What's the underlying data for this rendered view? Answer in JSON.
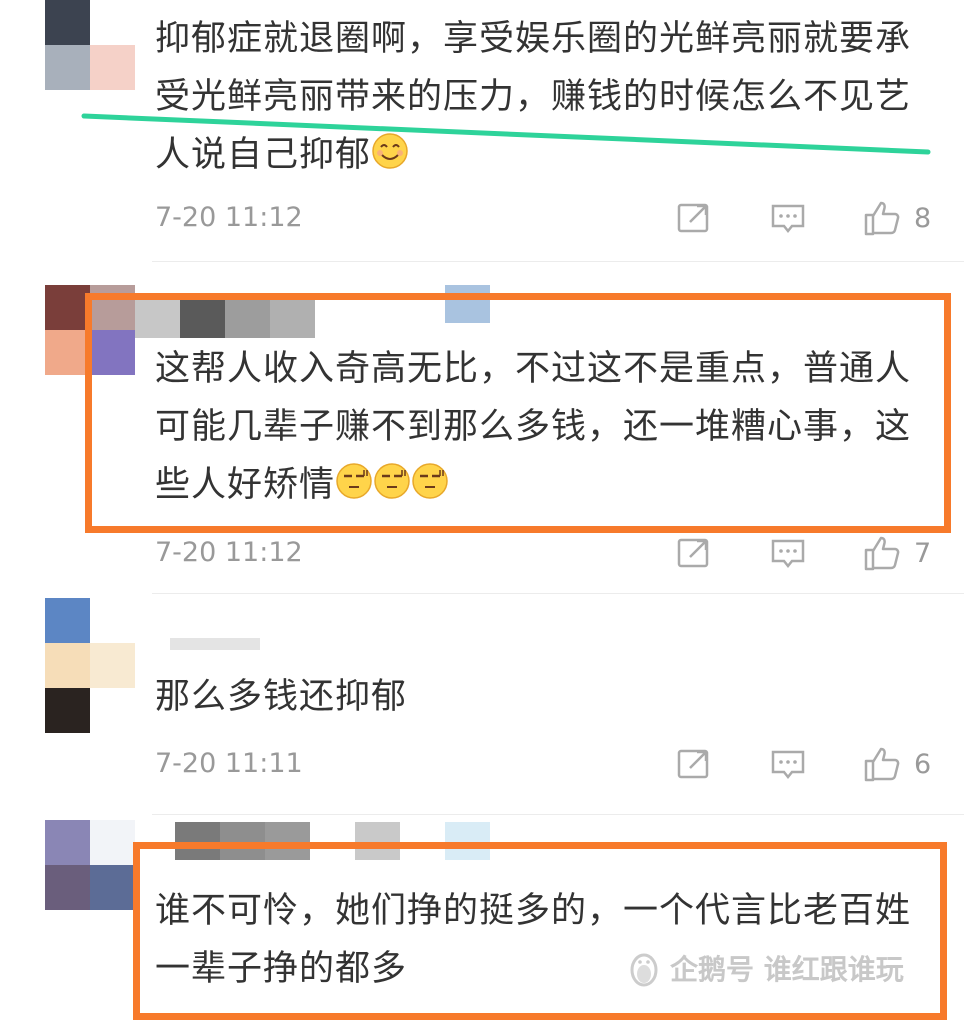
{
  "comments": [
    {
      "text": "抑郁症就退圈啊，享受娱乐圈的光鲜亮丽就要承受光鲜亮丽带来的压力，赚钱的时候怎么不见艺人说自己抑郁",
      "emojis": [
        "smile"
      ],
      "time": "7-20 11:12",
      "likes": "8",
      "highlight": "green-underline"
    },
    {
      "text": "这帮人收入奇高无比，不过这不是重点，普通人可能几辈子赚不到那么多钱，还一堆糟心事，这些人好矫情",
      "emojis": [
        "sleepy",
        "sleepy",
        "sleepy"
      ],
      "time": "7-20 11:12",
      "likes": "7",
      "highlight": "orange-box"
    },
    {
      "text": "那么多钱还抑郁",
      "emojis": [],
      "time": "7-20 11:11",
      "likes": "6",
      "highlight": "none"
    },
    {
      "text": "谁不可怜，她们挣的挺多的，一个代言比老百姓一辈子挣的都多",
      "emojis": [],
      "highlight": "orange-box"
    }
  ],
  "icons": {
    "share": "share-icon",
    "reply": "comment-icon",
    "like": "thumbs-up-icon"
  },
  "watermark": "企鹅号 谁红跟谁玩",
  "colors": {
    "highlight_orange": "#f77a2b",
    "underline_green": "#2ed39a",
    "text": "#333333",
    "meta": "#999999"
  }
}
